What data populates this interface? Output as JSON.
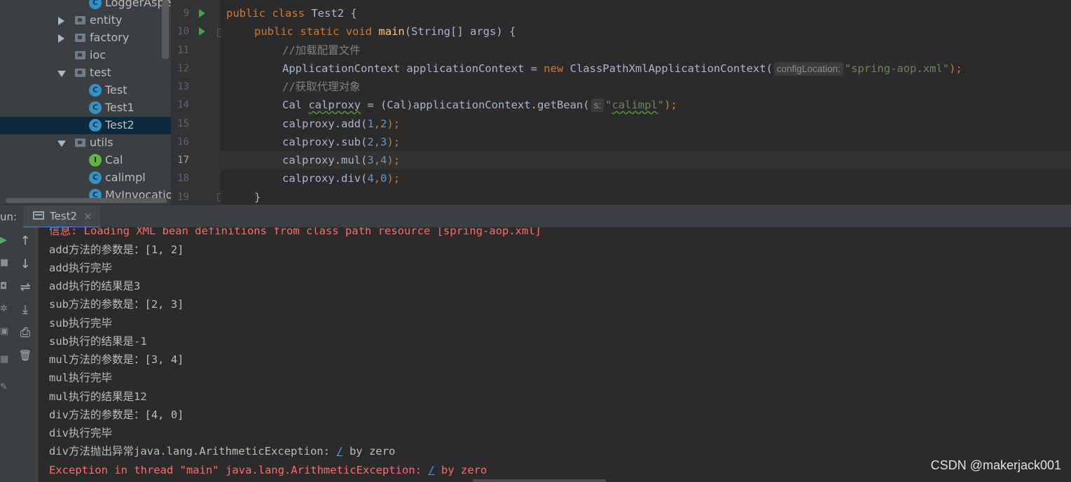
{
  "project_tree": {
    "items": [
      {
        "label": "LoggerAspect",
        "kind": "class"
      },
      {
        "label": "entity",
        "kind": "folder",
        "state": "collapsed"
      },
      {
        "label": "factory",
        "kind": "folder",
        "state": "collapsed"
      },
      {
        "label": "ioc",
        "kind": "folder",
        "state": "leaf"
      },
      {
        "label": "test",
        "kind": "folder",
        "state": "expanded"
      },
      {
        "label": "Test",
        "kind": "runnable-class"
      },
      {
        "label": "Test1",
        "kind": "runnable-class"
      },
      {
        "label": "Test2",
        "kind": "runnable-class",
        "selected": true
      },
      {
        "label": "utils",
        "kind": "folder",
        "state": "expanded"
      },
      {
        "label": "Cal",
        "kind": "interface",
        "icon_letter": "I"
      },
      {
        "label": "calimpl",
        "kind": "class"
      },
      {
        "label": "MyInvocation",
        "kind": "class"
      }
    ],
    "class_icon_letter": "C"
  },
  "editor": {
    "line_numbers": [
      "9",
      "10",
      "11",
      "12",
      "13",
      "14",
      "15",
      "16",
      "17",
      "18",
      "19"
    ],
    "current_line": "17",
    "lines": {
      "l9": {
        "kw1": "public",
        "kw2": "class",
        "rest": " Test2 {"
      },
      "l10": {
        "kw1": "public",
        "kw2": "static",
        "kw3": "void",
        "fn": "main",
        "rest": "(String[] args) {"
      },
      "l11": {
        "comment": "//加载配置文件"
      },
      "l12": {
        "pre": "ApplicationContext applicationContext = ",
        "kw": "new",
        "mid": " ClassPathXmlApplicationContext(",
        "hint": "configLocation:",
        "str": "\"spring-aop.xml\"",
        "end": ");"
      },
      "l13": {
        "comment": "//获取代理对象"
      },
      "l14": {
        "pre": "Cal ",
        "var": "calproxy",
        "mid": " = (Cal)applicationContext.getBean(",
        "hint": "s:",
        "q1": "\"",
        "str": "calimpl",
        "q2": "\"",
        "end": ");"
      },
      "l15": {
        "call": "calproxy.add(",
        "a": "1",
        "b": "2",
        "end": ");"
      },
      "l16": {
        "call": "calproxy.sub(",
        "a": "2",
        "b": "3",
        "end": ");"
      },
      "l17": {
        "call": "calproxy.mul(",
        "a": "3",
        "b": "4",
        "end": ");"
      },
      "l18": {
        "call": "calproxy.div(",
        "a": "4",
        "b": "0",
        "end": ");"
      },
      "l19": {
        "rest": "}"
      }
    }
  },
  "run_panel": {
    "label": "un:",
    "tab_label": "Test2",
    "tab_close": "×",
    "toolbar_icons": [
      "arrow-up-icon",
      "arrow-down-icon",
      "soft-wrap-icon",
      "scroll-to-end-icon",
      "print-icon",
      "trash-icon"
    ],
    "toolbar_glyphs": [
      "↑",
      "↓",
      "⇌",
      "⤓",
      "⎙",
      "🗑"
    ]
  },
  "console": {
    "info_line": "信息: Loading XML bean definitions from class path resource [spring-aop.xml]",
    "lines": [
      "add方法的参数是：[1, 2]",
      "add执行完毕",
      "add执行的结果是3",
      "sub方法的参数是：[2, 3]",
      "sub执行完毕",
      "sub执行的结果是-1",
      "mul方法的参数是：[3, 4]",
      "mul执行完毕",
      "mul执行的结果是12",
      "div方法的参数是：[4, 0]",
      "div执行完毕"
    ],
    "exception_line": {
      "pre": "div方法抛出异常java.lang.ArithmeticException: ",
      "link": "/",
      "post": " by zero"
    },
    "error_line": {
      "pre": "Exception in thread \"main\" java.lang.ArithmeticException: ",
      "link": "/",
      "post": " by zero"
    }
  },
  "watermark": "CSDN @makerjack001",
  "colors": {
    "keyword": "#cc7832",
    "string": "#6a8759",
    "number": "#6897bb",
    "comment": "#808080",
    "error": "#ff6b68",
    "link": "#5394ec"
  }
}
